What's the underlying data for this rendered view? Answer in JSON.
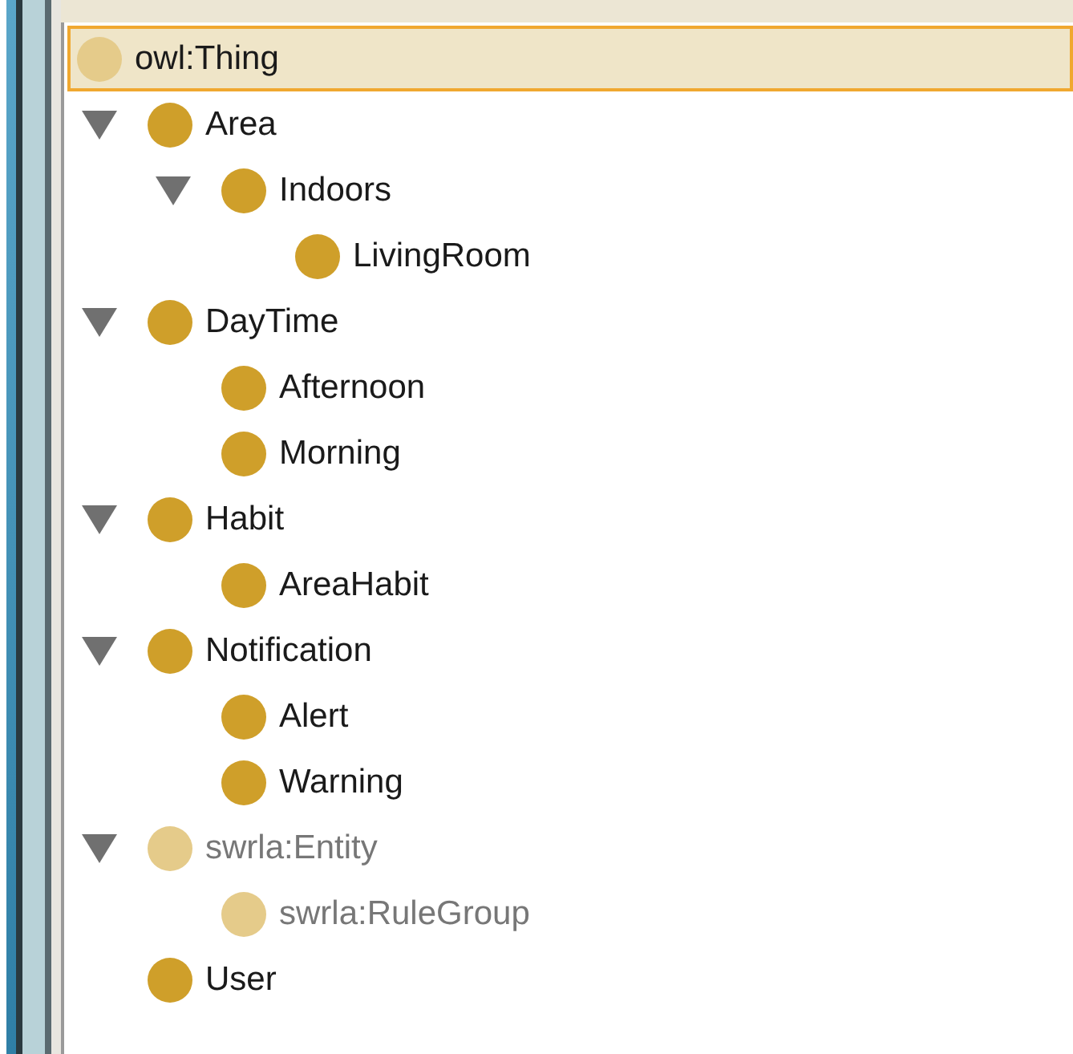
{
  "class_tree": {
    "root": {
      "label": "owl:Thing",
      "selected": true,
      "color": "#e5cb8a",
      "kind": "named",
      "children": [
        {
          "label": "Area",
          "selected": false,
          "color": "#cf9f2a",
          "kind": "named",
          "expanded": true,
          "children": [
            {
              "label": "Indoors",
              "selected": false,
              "color": "#cf9f2a",
              "kind": "named",
              "expanded": true,
              "children": [
                {
                  "label": "LivingRoom",
                  "selected": false,
                  "color": "#cf9f2a",
                  "kind": "named"
                }
              ]
            }
          ]
        },
        {
          "label": "DayTime",
          "selected": false,
          "color": "#cf9f2a",
          "kind": "named",
          "expanded": true,
          "children": [
            {
              "label": "Afternoon",
              "selected": false,
              "color": "#cf9f2a",
              "kind": "named"
            },
            {
              "label": "Morning",
              "selected": false,
              "color": "#cf9f2a",
              "kind": "named"
            }
          ]
        },
        {
          "label": "Habit",
          "selected": false,
          "color": "#cf9f2a",
          "kind": "named",
          "expanded": true,
          "children": [
            {
              "label": "AreaHabit",
              "selected": false,
              "color": "#cf9f2a",
              "kind": "named"
            }
          ]
        },
        {
          "label": "Notification",
          "selected": false,
          "color": "#cf9f2a",
          "kind": "named",
          "expanded": true,
          "children": [
            {
              "label": "Alert",
              "selected": false,
              "color": "#cf9f2a",
              "kind": "named"
            },
            {
              "label": "Warning",
              "selected": false,
              "color": "#cf9f2a",
              "kind": "named"
            }
          ]
        },
        {
          "label": "swrla:Entity",
          "selected": false,
          "color": "#e5cb8a",
          "kind": "builtin",
          "expanded": true,
          "children": [
            {
              "label": "swrla:RuleGroup",
              "selected": false,
              "color": "#e5cb8a",
              "kind": "builtin"
            }
          ]
        },
        {
          "label": "User",
          "selected": false,
          "color": "#cf9f2a",
          "kind": "named"
        }
      ]
    }
  }
}
